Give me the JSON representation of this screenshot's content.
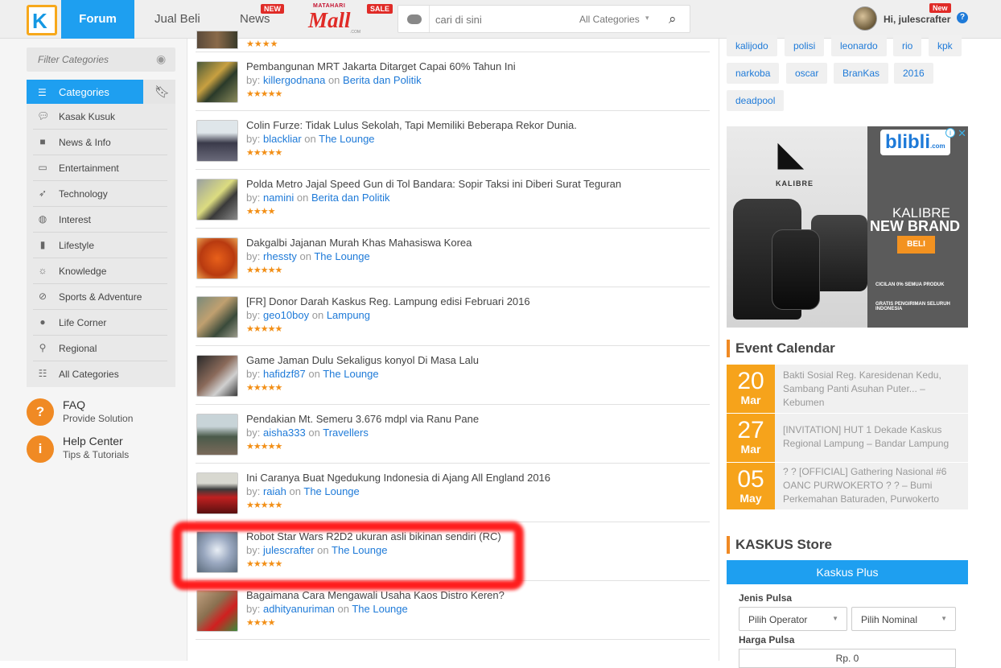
{
  "header": {
    "logo": "K",
    "nav": {
      "forum": "Forum",
      "jualbeli": "Jual Beli",
      "news": "News",
      "news_badge": "NEW"
    },
    "mall": {
      "top": "MATAHARI",
      "word": "Mall",
      "sub": ".COM",
      "badge": "SALE"
    },
    "search": {
      "placeholder": "cari di sini",
      "category": "All Categories"
    },
    "user": {
      "greeting": "Hi, julescrafter",
      "badge": "New"
    }
  },
  "sidebar": {
    "filter_placeholder": "Filter Categories",
    "tab_label": "Categories",
    "categories": [
      {
        "label": "Kasak Kusuk",
        "icon": "chat-icon"
      },
      {
        "label": "News & Info",
        "icon": "briefcase-icon"
      },
      {
        "label": "Entertainment",
        "icon": "tv-icon"
      },
      {
        "label": "Technology",
        "icon": "rocket-icon"
      },
      {
        "label": "Interest",
        "icon": "ball-icon"
      },
      {
        "label": "Lifestyle",
        "icon": "bottle-icon"
      },
      {
        "label": "Knowledge",
        "icon": "bulb-icon"
      },
      {
        "label": "Sports & Adventure",
        "icon": "compass-icon"
      },
      {
        "label": "Life Corner",
        "icon": "apple-icon"
      },
      {
        "label": "Regional",
        "icon": "pin-icon"
      },
      {
        "label": "All Categories",
        "icon": "tree-icon"
      }
    ],
    "faq": {
      "title": "FAQ",
      "subtitle": "Provide Solution"
    },
    "help": {
      "title": "Help Center",
      "subtitle": "Tips & Tutorials"
    }
  },
  "threads": [
    {
      "title": "Pembangunan MRT Jakarta Ditarget Capai 60% Tahun Ini",
      "author": "killergodnana",
      "forum": "Berita dan Politik",
      "stars": "★★★★★"
    },
    {
      "title": "Colin Furze: Tidak Lulus Sekolah, Tapi Memiliki Beberapa Rekor Dunia.",
      "author": "blackliar",
      "forum": "The Lounge",
      "stars": "★★★★★"
    },
    {
      "title": "Polda Metro Jajal Speed Gun di Tol Bandara: Sopir Taksi ini Diberi Surat Teguran",
      "author": "namini",
      "forum": "Berita dan Politik",
      "stars": "★★★★"
    },
    {
      "title": "Dakgalbi Jajanan Murah Khas Mahasiswa Korea",
      "author": "rhessty",
      "forum": "The Lounge",
      "stars": "★★★★★"
    },
    {
      "title": "[FR] Donor Darah Kaskus Reg. Lampung edisi Februari 2016",
      "author": "geo10boy",
      "forum": "Lampung",
      "stars": "★★★★★"
    },
    {
      "title": "Game Jaman Dulu Sekaligus konyol Di Masa Lalu",
      "author": "hafidzf87",
      "forum": "The Lounge",
      "stars": "★★★★★"
    },
    {
      "title": "Pendakian Mt. Semeru 3.676 mdpl via Ranu Pane",
      "author": "aisha333",
      "forum": "Travellers",
      "stars": "★★★★★"
    },
    {
      "title": "Ini Caranya Buat Ngedukung Indonesia di Ajang All England 2016",
      "author": "raiah",
      "forum": "The Lounge",
      "stars": "★★★★★"
    },
    {
      "title": "Robot Star Wars R2D2 ukuran asli bikinan sendiri (RC)",
      "author": "julescrafter",
      "forum": "The Lounge",
      "stars": "★★★★★"
    },
    {
      "title": "Bagaimana Cara Mengawali Usaha Kaos Distro Keren?",
      "author": "adhityanuriman",
      "forum": "The Lounge",
      "stars": "★★★★"
    }
  ],
  "by_label": "by:",
  "on_label": "on",
  "tags": [
    "kalijodo",
    "polisi",
    "leonardo",
    "rio",
    "kpk",
    "narkoba",
    "oscar",
    "BranKas",
    "2016",
    "deadpool"
  ],
  "ad": {
    "brand": "KALIBRE",
    "shop": "blibli",
    "shop_sub": ".com",
    "line1": "KALIBRE",
    "line2": "NEW BRAND",
    "cta": "BELI",
    "promo1": "CICILAN 0% SEMUA PRODUK",
    "promo2": "GRATIS PENGIRIMAN SELURUH INDONESIA"
  },
  "events": {
    "title": "Event Calendar",
    "items": [
      {
        "day": "20",
        "month": "Mar",
        "text": "Bakti Sosial Reg. Karesidenan Kedu, Sambang Panti Asuhan Puter... – Kebumen"
      },
      {
        "day": "27",
        "month": "Mar",
        "text": "[INVITATION] HUT 1 Dekade Kaskus Regional Lampung – Bandar Lampung"
      },
      {
        "day": "05",
        "month": "May",
        "text": "? ? [OFFICIAL] Gathering Nasional #6 OANC PURWOKERTO ? ? – Bumi Perkemahan Baturaden, Purwokerto"
      }
    ]
  },
  "store": {
    "title": "KASKUS Store",
    "tab": "Kaskus Plus",
    "jenis_label": "Jenis Pulsa",
    "operator": "Pilih Operator",
    "nominal": "Pilih Nominal",
    "harga_label": "Harga Pulsa",
    "harga": "Rp. 0"
  },
  "colors": {
    "primary": "#1e9ff0",
    "accent": "#f08a24",
    "link": "#1e7ad8",
    "star": "#f28f17"
  }
}
